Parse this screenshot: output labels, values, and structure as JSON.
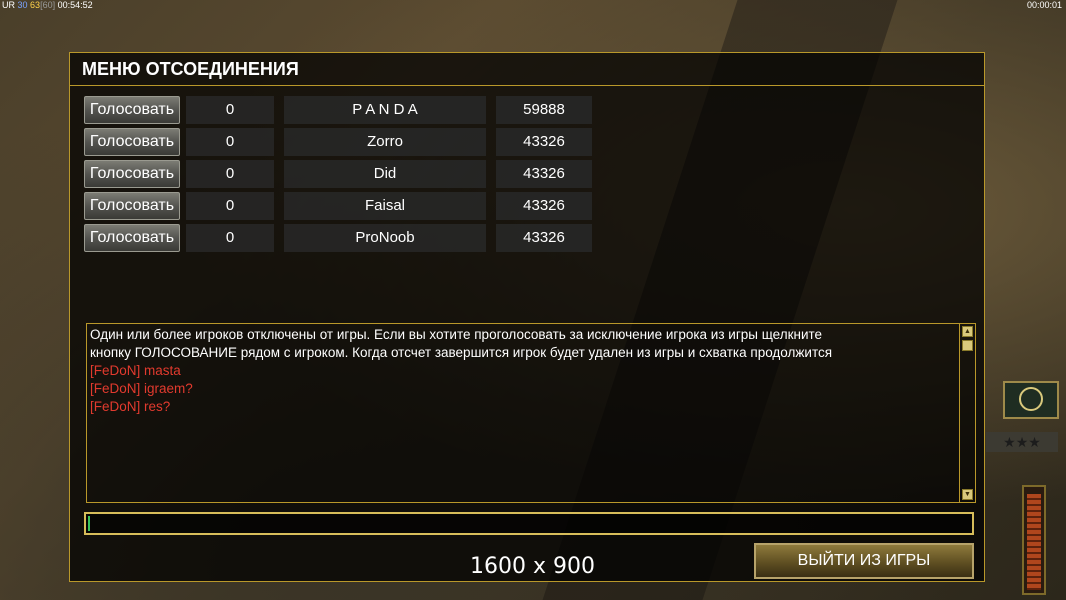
{
  "hud": {
    "fps_prefix": "UR",
    "fps1": "30",
    "fps2": "63",
    "fps3": "[60]",
    "time_left": "00:54:52",
    "time_right": "00:00:01"
  },
  "dialog": {
    "title": "МЕНЮ ОТСОЕДИНЕНИЯ",
    "rows": [
      {
        "vote": "Голосовать",
        "count": "0",
        "name": "P A N D A",
        "ping": "59888"
      },
      {
        "vote": "Голосовать",
        "count": "0",
        "name": "Zorro",
        "ping": "43326"
      },
      {
        "vote": "Голосовать",
        "count": "0",
        "name": "Did",
        "ping": "43326"
      },
      {
        "vote": "Голосовать",
        "count": "0",
        "name": "Faisal",
        "ping": "43326"
      },
      {
        "vote": "Голосовать",
        "count": "0",
        "name": "ProNoob",
        "ping": "43326"
      }
    ],
    "chat": [
      {
        "text": "Один или более игроков отключены от игры. Если вы хотите проголосовать за исключение игрока из игры щелкните",
        "color": "#ffffff"
      },
      {
        "text": " кнопку ГОЛОСОВАНИЕ рядом с игроком. Когда отсчет завершится игрок будет удален из игры и схватка продолжится",
        "color": "#ffffff"
      },
      {
        "text": "[FeDoN] masta",
        "color": "#e23a2e"
      },
      {
        "text": "[FeDoN] igraem?",
        "color": "#e23a2e"
      },
      {
        "text": "[FeDoN] res?",
        "color": "#e23a2e"
      }
    ],
    "exit_label": "ВЫЙТИ ИЗ ИГРЫ"
  },
  "overlay": {
    "resolution": "1600 x 900"
  },
  "hud_right": {
    "rank_stars": "★★★"
  }
}
